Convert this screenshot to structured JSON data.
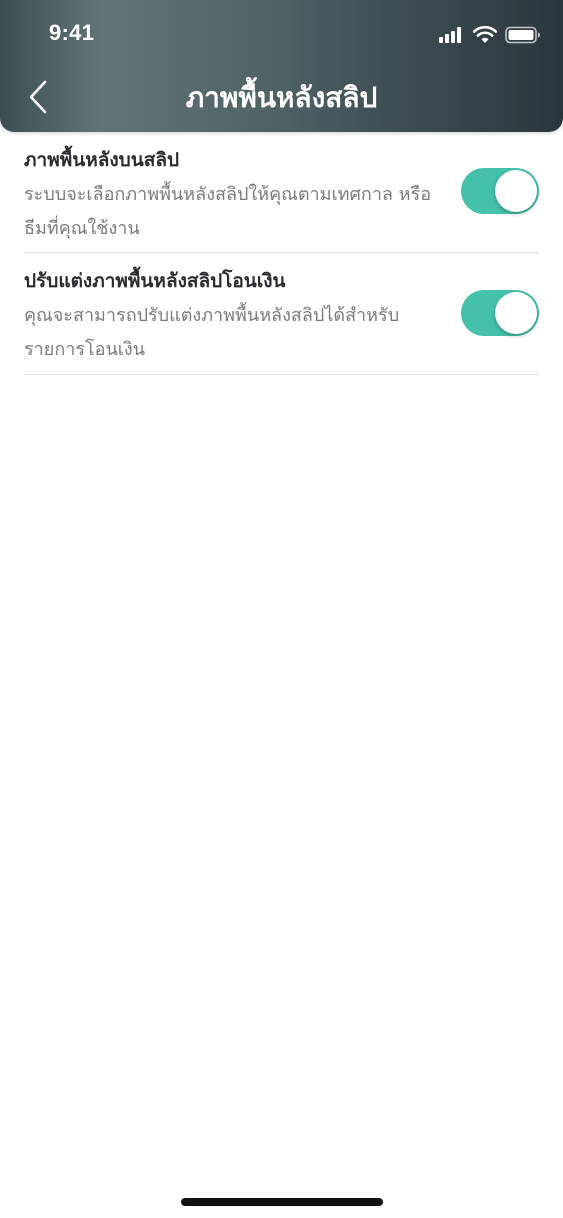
{
  "status_bar": {
    "time": "9:41",
    "icons": [
      "cellular-signal-icon",
      "wifi-icon",
      "battery-icon"
    ]
  },
  "header": {
    "back_icon": "chevron-left-icon",
    "title": "ภาพพื้นหลังสลิป"
  },
  "settings": [
    {
      "title": "ภาพพื้นหลังบนสลิป",
      "description": "ระบบจะเลือกภาพพื้นหลังสลิปให้คุณตามเทศกาล หรือธีมที่คุณใช้งาน",
      "enabled": true
    },
    {
      "title": "ปรับแต่งภาพพื้นหลังสลิปโอนเงิน",
      "description": "คุณจะสามารถปรับแต่งภาพพื้นหลังสลิปได้สำหรับ รายการโอนเงิน",
      "enabled": true
    }
  ],
  "colors": {
    "toggle_on": "#44c1ab",
    "header_gradient_dark": "#2a363b",
    "header_gradient_light": "#617476"
  }
}
